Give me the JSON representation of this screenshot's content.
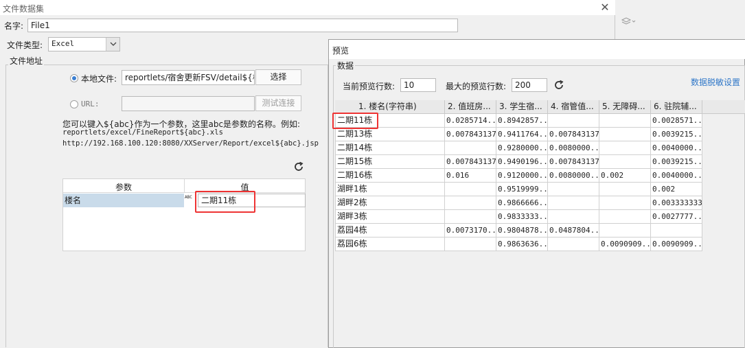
{
  "left_dialog": {
    "title": "文件数据集",
    "close_glyph": "✕",
    "name_label": "名字:",
    "name_value": "File1",
    "file_type_label": "文件类型:",
    "file_type_value": "Excel",
    "file_addr_legend": "文件地址",
    "local_file_label": "本地文件:",
    "local_file_value": "reportlets/宿舍更新FSV/detail${楼名}.xls",
    "select_button": "选择",
    "url_label": "URL:",
    "url_value": "",
    "test_button": "测试连接",
    "hint_line1": "您可以键入${abc}作为一个参数，这里abc是参数的名称。例如:",
    "hint_line2": "reportlets/excel/FineReport${abc}.xls",
    "hint_line3": "http://192.168.100.120:8080/XXServer/Report/excel${abc}.jsp",
    "refresh_glyph": "↻",
    "param_table": {
      "headers": [
        "参数",
        "值"
      ],
      "row": {
        "param": "楼名",
        "type_icon": "ABC",
        "value": "二期11栋"
      }
    }
  },
  "right_dialog": {
    "title": "预览",
    "data_legend": "数据",
    "current_rows_label": "当前预览行数:",
    "current_rows_value": "10",
    "max_rows_label": "最大的预览行数:",
    "max_rows_value": "200",
    "refresh_glyph": "↻",
    "desensitize_link": "数据脱敏设置",
    "columns": [
      "1. 楼名(字符串)",
      "2. 值班房...",
      "3. 学生宿...",
      "4. 宿管值...",
      "5. 无障碍...",
      "6. 驻院辅..."
    ],
    "rows": [
      [
        "二期11栋",
        "0.0285714...",
        "0.8942857...",
        "",
        "",
        "0.0028571..."
      ],
      [
        "二期13栋",
        "0.007843137",
        "0.9411764...",
        "0.007843137",
        "",
        "0.0039215..."
      ],
      [
        "二期14栋",
        "",
        "0.9280000...",
        "0.0080000...",
        "",
        "0.0040000..."
      ],
      [
        "二期15栋",
        "0.007843137",
        "0.9490196...",
        "0.007843137",
        "",
        "0.0039215..."
      ],
      [
        "二期16栋",
        "0.016",
        "0.9120000...",
        "0.0080000...",
        "0.002",
        "0.0040000..."
      ],
      [
        "湖畔1栋",
        "",
        "0.9519999...",
        "",
        "",
        "0.002"
      ],
      [
        "湖畔2栋",
        "",
        "0.9866666...",
        "",
        "",
        "0.003333333"
      ],
      [
        "湖畔3栋",
        "",
        "0.9833333...",
        "",
        "",
        "0.0027777..."
      ],
      [
        "荔园4栋",
        "0.0073170...",
        "0.9804878...",
        "0.0487804...",
        "",
        ""
      ],
      [
        "荔园6栋",
        "",
        "0.9863636...",
        "",
        "0.0090909...",
        "0.0090909..."
      ]
    ]
  }
}
